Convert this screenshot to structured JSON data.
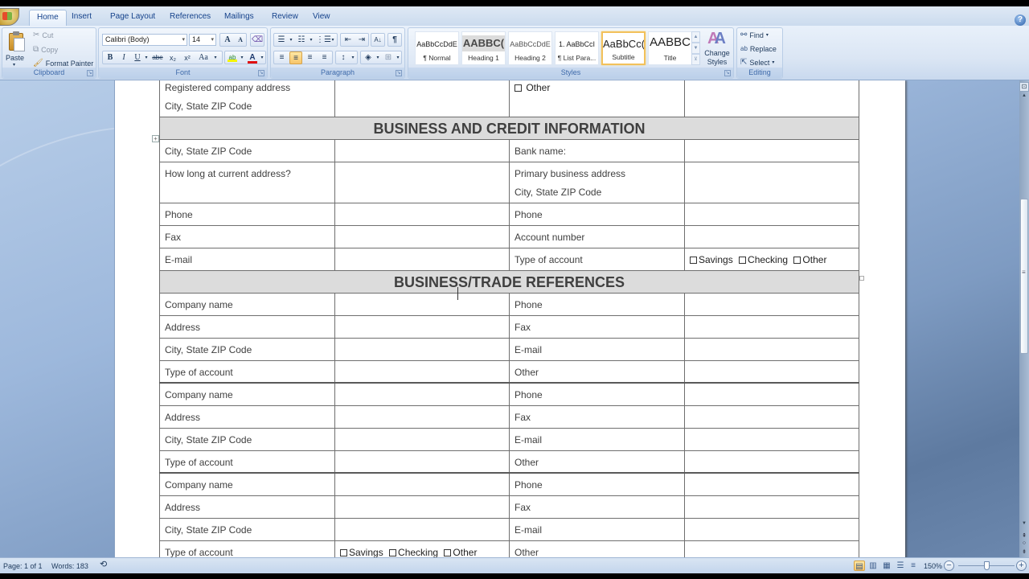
{
  "ribbon": {
    "tabs": [
      {
        "label": "Home",
        "active": true
      },
      {
        "label": "Insert",
        "active": false
      },
      {
        "label": "Page Layout",
        "active": false
      },
      {
        "label": "References",
        "active": false
      },
      {
        "label": "Mailings",
        "active": false
      },
      {
        "label": "Review",
        "active": false
      },
      {
        "label": "View",
        "active": false
      }
    ],
    "clipboard": {
      "label": "Clipboard",
      "paste": "Paste",
      "cut": "Cut",
      "copy": "Copy",
      "format_painter": "Format Painter"
    },
    "font": {
      "label": "Font",
      "font_name": "Calibri (Body)",
      "font_size": "14",
      "grow_font": "A",
      "shrink_font": "A",
      "bold": "B",
      "italic": "I",
      "underline": "U",
      "strikethrough": "abe",
      "subscript": "x₂",
      "superscript": "x²",
      "change_case": "Aa",
      "highlight_color": "#f4f400",
      "font_color": "#e01010"
    },
    "paragraph": {
      "label": "Paragraph",
      "active_alignment": "center"
    },
    "styles": {
      "label": "Styles",
      "items": [
        {
          "sample": "AaBbCcDdE",
          "name": "¶ Normal",
          "selected": false
        },
        {
          "sample": "AABBC(",
          "name": "Heading 1",
          "selected": false
        },
        {
          "sample": "AaBbCcDdE",
          "name": "Heading 2",
          "selected": false
        },
        {
          "sample": "1. AaBbCcI",
          "name": "¶ List Para...",
          "selected": false
        },
        {
          "sample": "AaBbCc(",
          "name": "Subtitle",
          "selected": true
        },
        {
          "sample": "AABBC",
          "name": "Title",
          "selected": false
        }
      ],
      "change_styles": "Change Styles"
    },
    "editing": {
      "label": "Editing",
      "find": "Find",
      "replace": "Replace",
      "select": "Select"
    }
  },
  "document": {
    "top_rows": [
      {
        "left_label": "Registered company address",
        "left_label2": "City, State ZIP Code",
        "right_checkbox": "Other"
      }
    ],
    "section1": {
      "title": "BUSINESS AND CREDIT INFORMATION",
      "rows": [
        {
          "left": "City, State ZIP Code",
          "right": "Bank name:"
        },
        {
          "left": "How long at current address?",
          "right": "Primary business address",
          "right2": "City, State ZIP Code"
        },
        {
          "left": "Phone",
          "right": "Phone"
        },
        {
          "left": "Fax",
          "right": "Account number"
        },
        {
          "left": "E-mail",
          "right": "Type of account",
          "right_value_options": [
            "Savings",
            "Checking",
            "Other"
          ]
        }
      ]
    },
    "section2": {
      "title": "BUSINESS/TRADE REFERENCES",
      "groups": [
        {
          "rows": [
            {
              "left": "Company name",
              "right": "Phone"
            },
            {
              "left": "Address",
              "right": "Fax"
            },
            {
              "left": "City, State ZIP Code",
              "right": "E-mail"
            },
            {
              "left": "Type of account",
              "right": "Other"
            }
          ]
        },
        {
          "rows": [
            {
              "left": "Company name",
              "right": "Phone"
            },
            {
              "left": "Address",
              "right": "Fax"
            },
            {
              "left": "City, State ZIP Code",
              "right": "E-mail"
            },
            {
              "left": "Type of account",
              "right": "Other"
            }
          ]
        },
        {
          "rows": [
            {
              "left": "Company name",
              "right": "Phone"
            },
            {
              "left": "Address",
              "right": "Fax"
            },
            {
              "left": "City, State ZIP Code",
              "right": "E-mail"
            },
            {
              "left": "Type of account",
              "right": "Other",
              "value_options": [
                "Savings",
                "Checking",
                "Other"
              ]
            }
          ]
        }
      ]
    }
  },
  "status": {
    "page": "Page: 1 of 1",
    "words": "Words: 183",
    "zoom": "150%",
    "zoom_level_percent": 150
  }
}
